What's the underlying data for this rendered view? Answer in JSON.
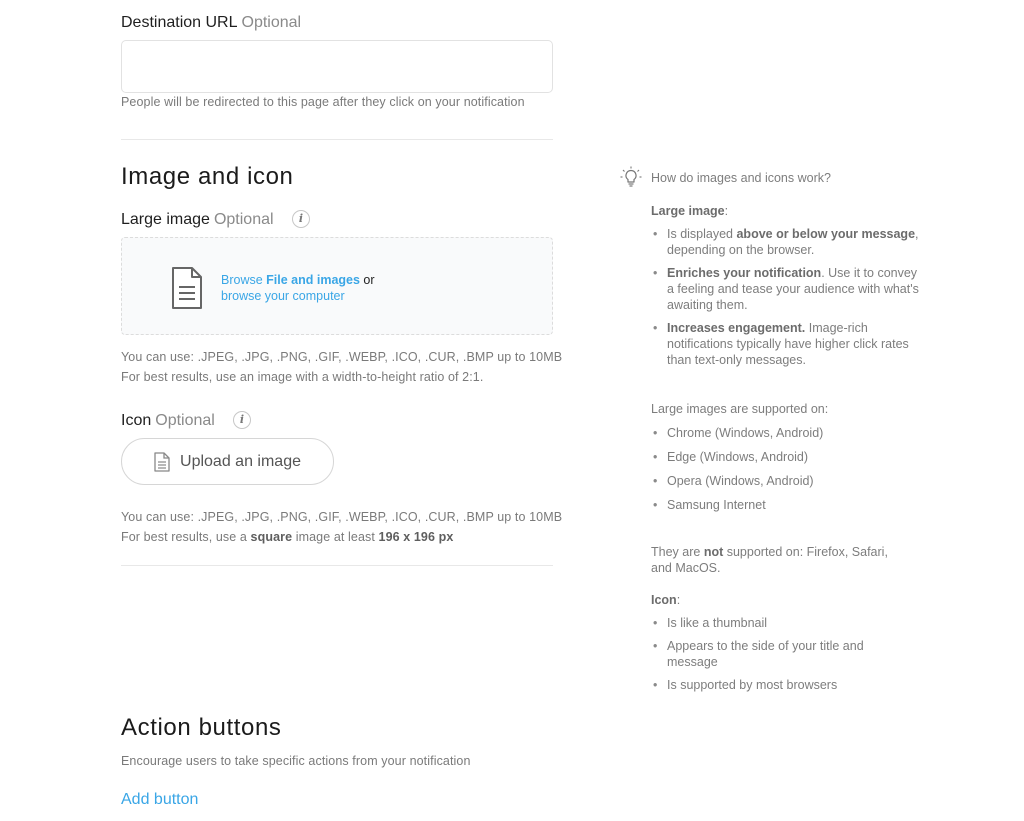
{
  "destination": {
    "label": "Destination URL",
    "optional": "Optional",
    "value": "",
    "help": "People will be redirected to this page after they click on your notification"
  },
  "image_section": {
    "title": "Image and icon",
    "large_image": {
      "label": "Large image",
      "optional": "Optional",
      "browse_prefix": "Browse ",
      "browse_link": "File and images",
      "or_text": " or",
      "browse_computer": "browse your computer",
      "help_formats": "You can use: .JPEG, .JPG, .PNG, .GIF, .WEBP, .ICO, .CUR, .BMP up to 10MB",
      "help_ratio": "For best results, use an image with a width-to-height ratio of 2:1."
    },
    "icon": {
      "label": "Icon",
      "optional": "Optional",
      "upload_label": "Upload an image",
      "help_formats": "You can use: .JPEG, .JPG, .PNG, .GIF, .WEBP, .ICO, .CUR, .BMP up to 10MB",
      "help_prefix": "For best results, use a ",
      "help_bold1": "square",
      "help_mid": " image at least ",
      "help_bold2": "196 x 196 px"
    }
  },
  "action_section": {
    "title": "Action buttons",
    "description": "Encourage users to take specific actions from your notification",
    "add_button": "Add button"
  },
  "sidebar_help": {
    "heading": "How do images and icons work?",
    "large_image_title": "Large image",
    "colon": ":",
    "large_points": [
      {
        "pre": "Is displayed ",
        "bold": "above or below your message",
        "post": ", depending on the browser."
      },
      {
        "pre": "",
        "bold": "Enriches your notification",
        "post": ". Use it to convey a feeling and tease your audience with what's awaiting them."
      },
      {
        "pre": "",
        "bold": "Increases engagement.",
        "post": " Image-rich notifications typically have higher click rates than text-only messages."
      }
    ],
    "supported_title": "Large images are supported on:",
    "supported": [
      "Chrome (Windows, Android)",
      "Edge (Windows, Android)",
      "Opera (Windows, Android)",
      "Samsung Internet"
    ],
    "not_pre": "They are ",
    "not_bold": "not",
    "not_post": " supported on: Firefox, Safari, and MacOS.",
    "icon_title": "Icon",
    "icon_points": [
      "Is like a thumbnail",
      "Appears to the side of your title and message",
      "Is supported by most browsers"
    ]
  }
}
